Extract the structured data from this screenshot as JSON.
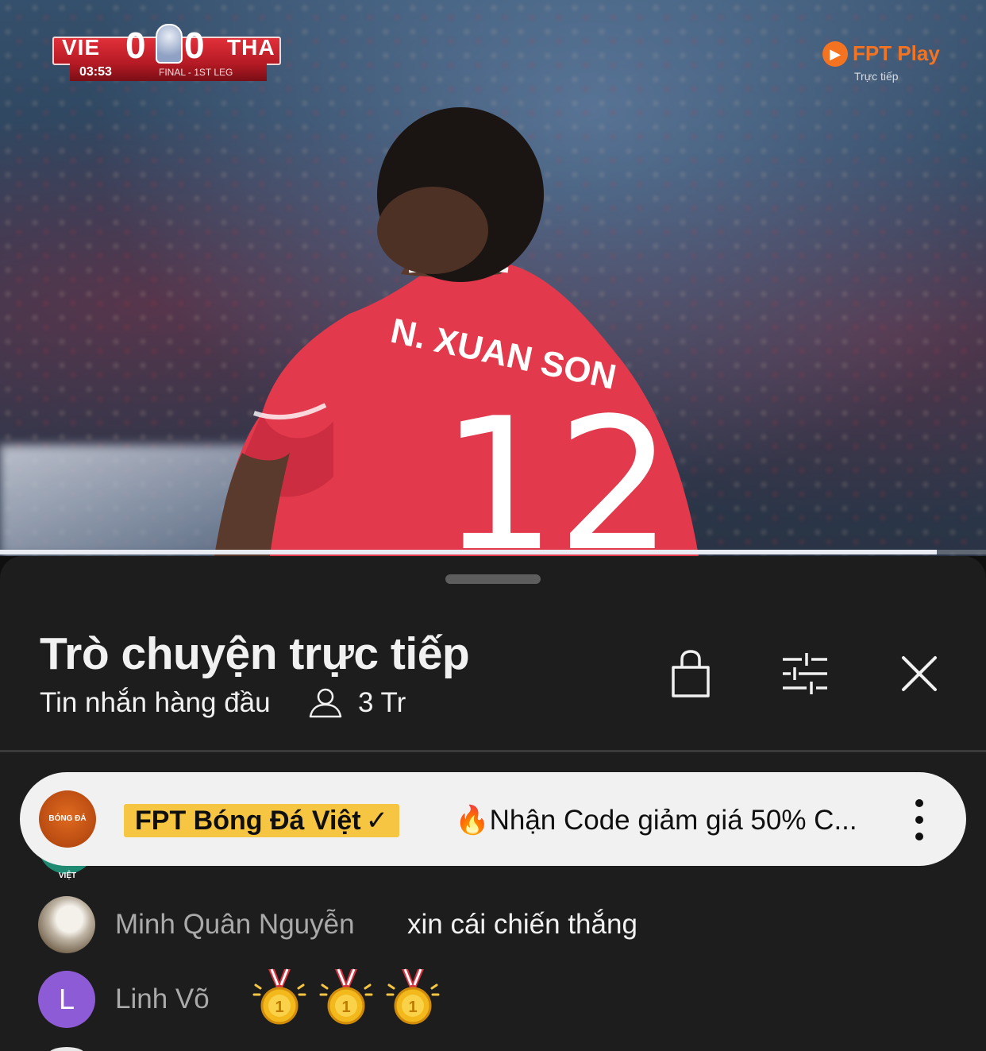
{
  "video": {
    "scoreboard": {
      "home_team": "VIE",
      "away_team": "THA",
      "home_score": "0",
      "away_score": "0",
      "match_time": "03:53",
      "stage": "FINAL - 1ST LEG"
    },
    "broadcaster": {
      "name": "FPT Play",
      "status": "Trực tiếp",
      "accent_color": "#f47321"
    },
    "jersey_name": "N. XUAN SON",
    "jersey_number": "12",
    "progress": 0.95
  },
  "chat": {
    "title": "Trò chuyện trực tiếp",
    "mode": "Tin nhắn hàng đầu",
    "viewers": "3 Tr",
    "icons": {
      "viewers": "person-icon",
      "shop": "shopping-bag-icon",
      "filter": "sliders-icon",
      "close": "close-icon"
    },
    "pinned": {
      "channel": "FPT Bóng Đá Việt",
      "verified_mark": "✓",
      "avatar_text": "BÓNG ĐÁ VIỆT",
      "message": "🔥Nhận Code giảm giá 50% C...",
      "badge_color": "#f6c542",
      "menu_icon": "more-vertical-icon"
    },
    "messages": [
      {
        "author": "Minh Quân Nguyễn",
        "text": "xin cái chiến thắng",
        "avatar": "photo"
      },
      {
        "author": "Linh Võ",
        "avatar_letter": "L",
        "avatar_color": "#8e5bd6",
        "emoji": "gold-medal-icon",
        "emoji_count": 3
      }
    ]
  }
}
